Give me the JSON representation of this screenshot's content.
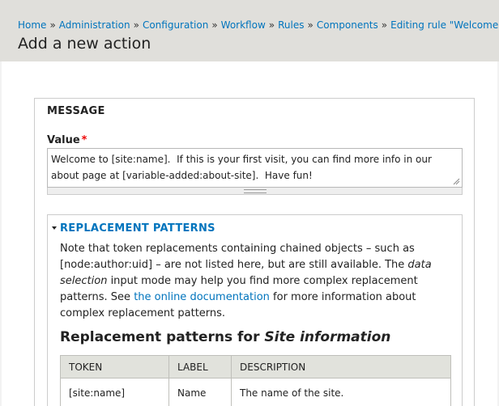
{
  "breadcrumb": {
    "items": [
      "Home",
      "Administration",
      "Configuration",
      "Workflow",
      "Rules",
      "Components",
      "Editing rule \"Welcome\""
    ],
    "separator": "»"
  },
  "page": {
    "title": "Add a new action"
  },
  "message_fieldset": {
    "legend": "MESSAGE",
    "value_label": "Value",
    "required_mark": "*",
    "textarea_value": "Welcome to [site:name].  If this is your first visit, you can find more info in our about page at [variable-added:about-site].  Have fun!"
  },
  "replacement_patterns": {
    "toggle_label": "REPLACEMENT PATTERNS",
    "desc_part1": "Note that token replacements containing chained objects – such as [node:author:uid] – are not listed here, but are still available. The ",
    "desc_em1": "data selection",
    "desc_part2": " input mode may help you find more complex replacement patterns. See ",
    "desc_link": "the online documentation",
    "desc_part3": " for more information about complex replacement patterns.",
    "heading_prefix": "Replacement patterns for ",
    "heading_em": "Site information",
    "table": {
      "headers": [
        "TOKEN",
        "LABEL",
        "DESCRIPTION"
      ],
      "rows": [
        {
          "token": "[site:name]",
          "label": "Name",
          "description": "The name of the site."
        }
      ]
    }
  },
  "colors": {
    "header_bg": "#e0dfdb",
    "link": "#0074bd",
    "required": "#ee0000",
    "table_header_bg": "#e1e2dc"
  }
}
